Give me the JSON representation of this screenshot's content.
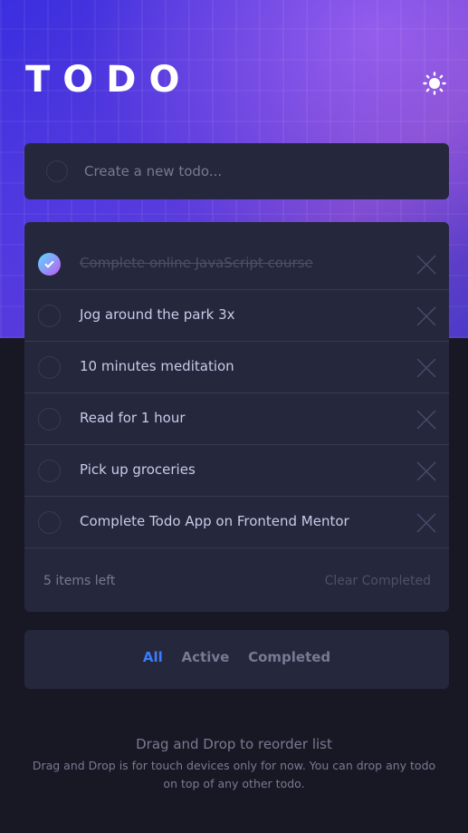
{
  "header": {
    "title": "TODO",
    "theme_icon": "sun-icon"
  },
  "new_todo": {
    "placeholder": "Create a new todo..."
  },
  "todos": [
    {
      "text": "Complete online JavaScript course",
      "completed": true
    },
    {
      "text": "Jog around the park 3x",
      "completed": false
    },
    {
      "text": "10 minutes meditation",
      "completed": false
    },
    {
      "text": "Read for 1 hour",
      "completed": false
    },
    {
      "text": "Pick up groceries",
      "completed": false
    },
    {
      "text": "Complete Todo App on Frontend Mentor",
      "completed": false
    }
  ],
  "footer": {
    "items_left": "5 items left",
    "clear_completed": "Clear Completed"
  },
  "filters": {
    "all": "All",
    "active": "Active",
    "completed": "Completed",
    "selected": "All"
  },
  "hint": {
    "title": "Drag and Drop to reorder list",
    "description": "Drag and Drop is for touch devices only for now. You can drop any todo on top of any other todo."
  },
  "colors": {
    "accent": "#3a7cfd",
    "check_gradient_start": "#57ddff",
    "check_gradient_end": "#c058f3",
    "card_bg": "#25273d",
    "page_bg": "#181824"
  }
}
